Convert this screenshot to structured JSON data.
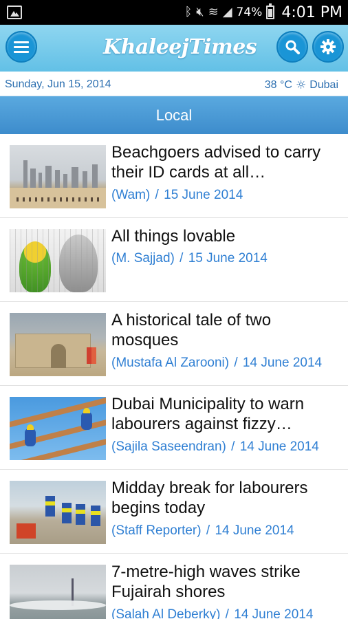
{
  "status_bar": {
    "battery": "74%",
    "time": "4:01 PM",
    "icons": [
      "gallery-icon",
      "bluetooth-icon",
      "mute-icon",
      "wifi-icon",
      "signal-icon",
      "battery-icon"
    ]
  },
  "header": {
    "logo_text": "KhaleejTimes",
    "menu_icon": "hamburger-icon",
    "search_icon": "search-icon",
    "settings_icon": "gear-icon"
  },
  "date_bar": {
    "date": "Sunday, Jun 15, 2014",
    "temperature": "38 °C",
    "city": "Dubai",
    "weather_icon": "sun-icon"
  },
  "section": {
    "title": "Local"
  },
  "colors": {
    "header_bg": "#62c0e6",
    "button_blue": "#1a95d6",
    "section_bar": "#4a99d6",
    "meta_text": "#2f7fd3"
  },
  "articles": [
    {
      "title": "Beachgoers advised to carry their ID cards at all…",
      "source": "(Wam)",
      "date": "15 June 2014"
    },
    {
      "title": "All things lovable",
      "source": "(M. Sajjad)",
      "date": "15 June 2014"
    },
    {
      "title": "A historical tale of two mosques",
      "source": "(Mustafa Al Zarooni)",
      "date": "14 June 2014"
    },
    {
      "title": "Dubai Municipality to warn labourers against fizzy…",
      "source": "(Sajila Saseendran)",
      "date": "14 June 2014"
    },
    {
      "title": "Midday break for labourers begins today",
      "source": "(Staff Reporter)",
      "date": "14 June 2014"
    },
    {
      "title": "7-metre-high waves strike Fujairah shores",
      "source": "(Salah Al Deberky)",
      "date": "14 June 2014"
    }
  ]
}
